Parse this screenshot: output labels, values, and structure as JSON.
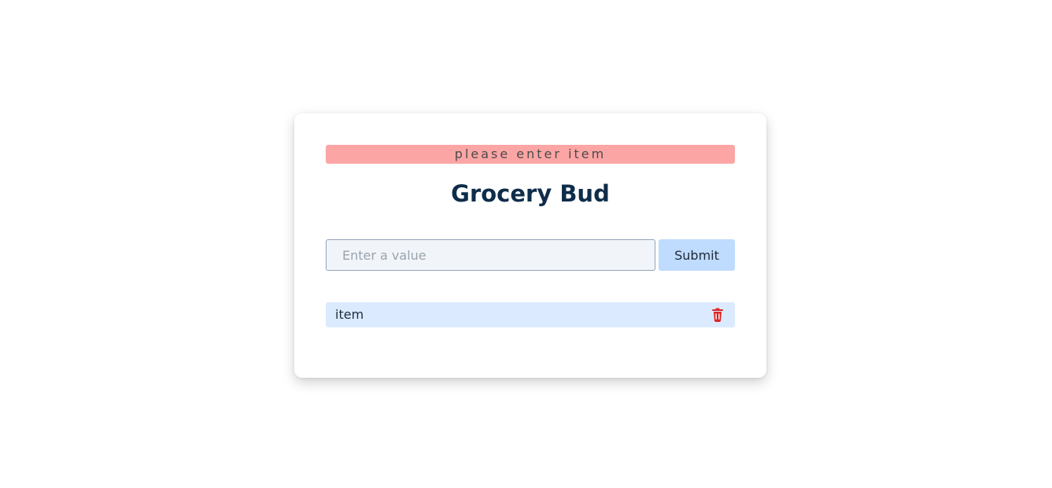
{
  "alert": {
    "text": "please enter item",
    "color": "#fca5a5"
  },
  "header": {
    "title": "Grocery Bud"
  },
  "form": {
    "input_value": "",
    "input_placeholder": "Enter a value",
    "submit_label": "Submit"
  },
  "items": [
    {
      "label": "item",
      "delete_icon": "trash-icon"
    }
  ],
  "colors": {
    "title": "#0f2d4a",
    "submit_bg": "#bfdbfe",
    "item_bg": "#dbeafe",
    "delete_icon": "#dc2626"
  }
}
